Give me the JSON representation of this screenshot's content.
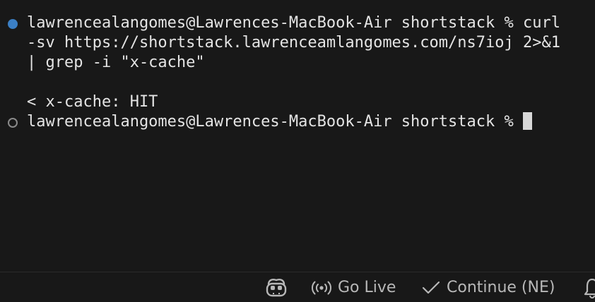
{
  "terminal": {
    "lines": [
      "lawrencealangomes@Lawrences-MacBook-Air shortstack % curl",
      "-sv https://shortstack.lawrenceamlangomes.com/ns7ioj 2>&1",
      "| grep -i \"x-cache\"",
      "",
      "< x-cache: HIT",
      "lawrencealangomes@Lawrences-MacBook-Air shortstack % "
    ],
    "command_marker_status": "completed",
    "prompt_marker_status": "idle",
    "colors": {
      "background": "#181818",
      "text": "#e4e4e4",
      "completed_marker": "#3b7fc4",
      "idle_marker": "#8a8a8a"
    }
  },
  "statusbar": {
    "copilot_icon": "copilot-icon",
    "go_live_icon": "broadcast-icon",
    "go_live_label": "Go Live",
    "continue_icon": "check-icon",
    "continue_label": "Continue (NE)",
    "notifications_icon": "bell-icon"
  }
}
